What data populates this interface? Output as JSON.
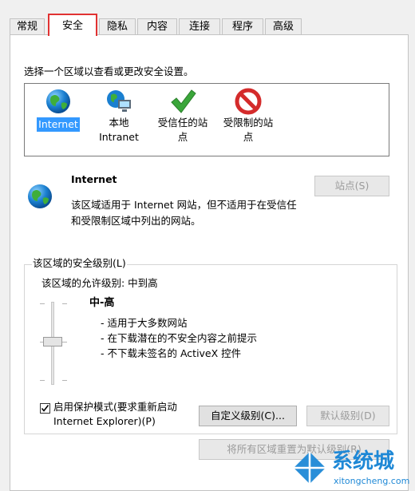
{
  "tabs": [
    {
      "label": "常规"
    },
    {
      "label": "安全"
    },
    {
      "label": "隐私"
    },
    {
      "label": "内容"
    },
    {
      "label": "连接"
    },
    {
      "label": "程序"
    },
    {
      "label": "高级"
    }
  ],
  "active_tab": "安全",
  "zone_prompt": "选择一个区域以查看或更改安全设置。",
  "zones": [
    {
      "label": "Internet",
      "icon": "globe-icon"
    },
    {
      "label_line1": "本地",
      "label_line2": "Intranet",
      "icon": "intranet-icon"
    },
    {
      "label_line1": "受信任的站",
      "label_line2": "点",
      "icon": "checkmark-icon"
    },
    {
      "label_line1": "受限制的站",
      "label_line2": "点",
      "icon": "no-entry-icon"
    }
  ],
  "selected_zone": {
    "name": "Internet",
    "desc_line1": "该区域适用于 Internet 网站，但不适用于在受信任",
    "desc_line2": "和受限制区域中列出的网站。"
  },
  "sites_button": "站点(S)",
  "security_level": {
    "legend": "该区域的安全级别(L)",
    "allowed_levels": "该区域的允许级别: 中到高",
    "level_name": "中-高",
    "bullets": [
      "- 适用于大多数网站",
      "- 在下载潜在的不安全内容之前提示",
      "- 不下载未签名的 ActiveX 控件"
    ]
  },
  "protected_mode": {
    "line1": "启用保护模式(要求重新启动",
    "line2": "Internet Explorer)(P)",
    "checked": true
  },
  "custom_level_button": "自定义级别(C)...",
  "default_level_button": "默认级别(D)",
  "reset_all_button": "将所有区域重置为默认级别(R)",
  "watermark": {
    "brand": "系统城",
    "url": "xitongcheng.com"
  },
  "colors": {
    "active_tab_outline": "#e13232",
    "selection": "#3399ff",
    "trusted_green": "#3aa63a",
    "restricted_red": "#d42b2b",
    "watermark_blue": "#1e88d6"
  }
}
